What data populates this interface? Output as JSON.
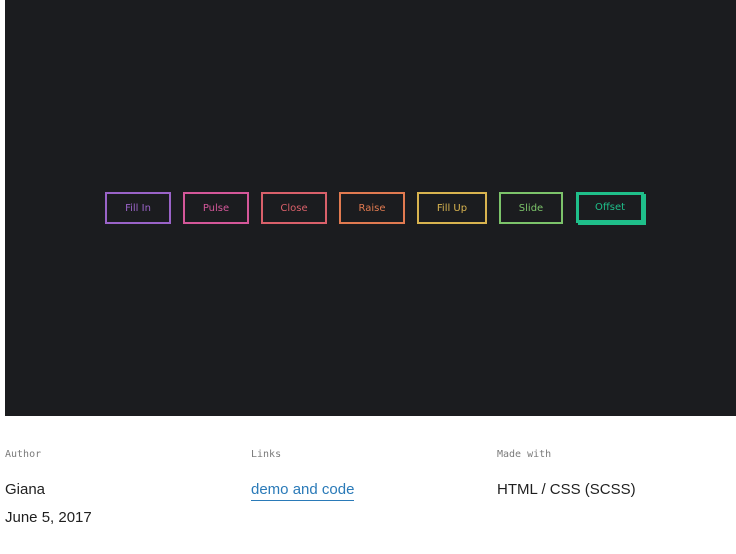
{
  "demo": {
    "buttons": [
      {
        "label": "Fill In",
        "color": "#9a63c8"
      },
      {
        "label": "Pulse",
        "color": "#d45799"
      },
      {
        "label": "Close",
        "color": "#d9606a"
      },
      {
        "label": "Raise",
        "color": "#e17a50"
      },
      {
        "label": "Fill Up",
        "color": "#d8b34f"
      },
      {
        "label": "Slide",
        "color": "#7cc36a"
      },
      {
        "label": "Offset",
        "color": "#1fbf8a"
      }
    ]
  },
  "meta": {
    "author": {
      "label": "Author",
      "name": "Giana",
      "date": "June 5, 2017"
    },
    "links": {
      "label": "Links",
      "link_text": "demo and code"
    },
    "made_with": {
      "label": "Made with",
      "value": "HTML / CSS (SCSS)"
    }
  }
}
